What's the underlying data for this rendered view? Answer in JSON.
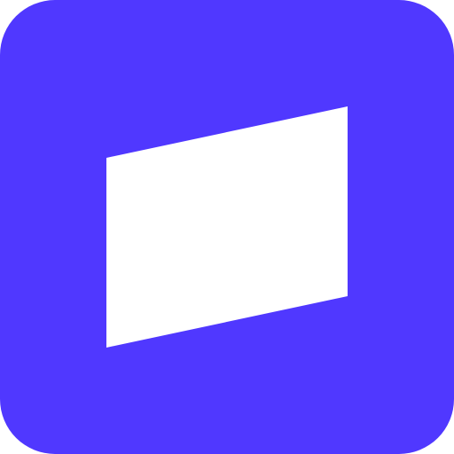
{
  "icon": {
    "name": "app-logo",
    "colors": {
      "background": "#5038FF",
      "foreground": "#FFFFFF"
    }
  }
}
